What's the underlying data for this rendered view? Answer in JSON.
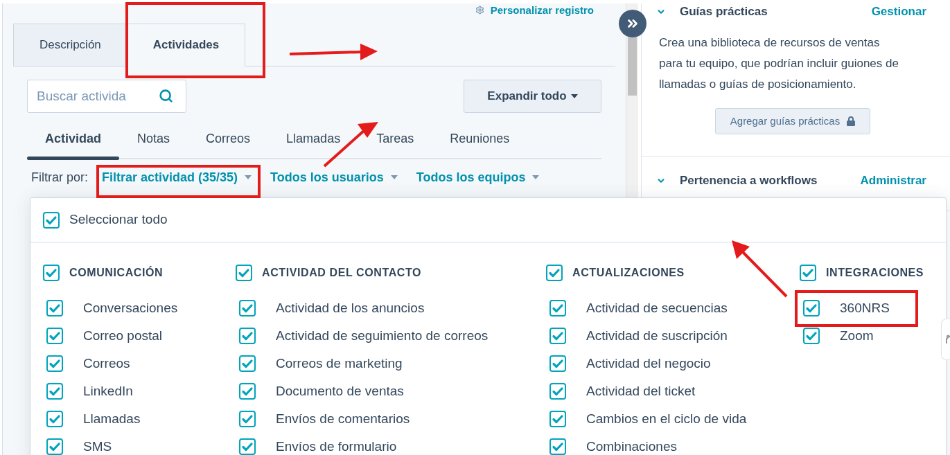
{
  "record_header": {
    "customize_link": "Personalizar registro"
  },
  "tabs": [
    {
      "label": "Descripción",
      "selected": false
    },
    {
      "label": "Actividades",
      "selected": true
    }
  ],
  "search": {
    "placeholder": "Buscar activida"
  },
  "expand_button": {
    "label": "Expandir todo"
  },
  "activity_tabs": [
    {
      "label": "Actividad",
      "selected": true
    },
    {
      "label": "Notas",
      "selected": false
    },
    {
      "label": "Correos",
      "selected": false
    },
    {
      "label": "Llamadas",
      "selected": false
    },
    {
      "label": "Tareas",
      "selected": false
    },
    {
      "label": "Reuniones",
      "selected": false
    }
  ],
  "filter_bar": {
    "label": "Filtrar por:",
    "filters": [
      "Filtrar actividad (35/35)",
      "Todos los usuarios",
      "Todos los equipos"
    ]
  },
  "filter_menu": {
    "select_all": {
      "label": "Seleccionar todo",
      "checked": true
    },
    "groups": [
      {
        "title": "COMUNICACIÓN",
        "checked": true,
        "items": [
          {
            "label": "Conversaciones",
            "checked": true
          },
          {
            "label": "Correo postal",
            "checked": true
          },
          {
            "label": "Correos",
            "checked": true
          },
          {
            "label": "LinkedIn",
            "checked": true
          },
          {
            "label": "Llamadas",
            "checked": true
          },
          {
            "label": "SMS",
            "checked": true
          }
        ]
      },
      {
        "title": "ACTIVIDAD DEL CONTACTO",
        "checked": true,
        "items": [
          {
            "label": "Actividad de los anuncios",
            "checked": true
          },
          {
            "label": "Actividad de seguimiento de correos",
            "checked": true
          },
          {
            "label": "Correos de marketing",
            "checked": true
          },
          {
            "label": "Documento de ventas",
            "checked": true
          },
          {
            "label": "Envíos de comentarios",
            "checked": true
          },
          {
            "label": "Envíos de formulario",
            "checked": true
          }
        ]
      },
      {
        "title": "ACTUALIZACIONES",
        "checked": true,
        "items": [
          {
            "label": "Actividad de secuencias",
            "checked": true
          },
          {
            "label": "Actividad de suscripción",
            "checked": true
          },
          {
            "label": "Actividad del negocio",
            "checked": true
          },
          {
            "label": "Actividad del ticket",
            "checked": true
          },
          {
            "label": "Cambios en el ciclo de vida",
            "checked": true
          },
          {
            "label": "Combinaciones",
            "checked": true
          }
        ]
      },
      {
        "title": "INTEGRACIONES",
        "checked": true,
        "items": [
          {
            "label": "360NRS",
            "checked": true
          },
          {
            "label": "Zoom",
            "checked": true
          }
        ]
      }
    ]
  },
  "sidebar": {
    "sections": [
      {
        "title": "Guías prácticas",
        "action": "Gestionar",
        "expanded": true,
        "description": "Crea una biblioteca de recursos de ventas para tu equipo, que podrían incluir guiones de llamadas o guías de posicionamiento.",
        "button": "Agregar guías prácticas"
      },
      {
        "title": "Pertenencia a workflows",
        "action": "Administrar",
        "expanded": true
      }
    ]
  }
}
